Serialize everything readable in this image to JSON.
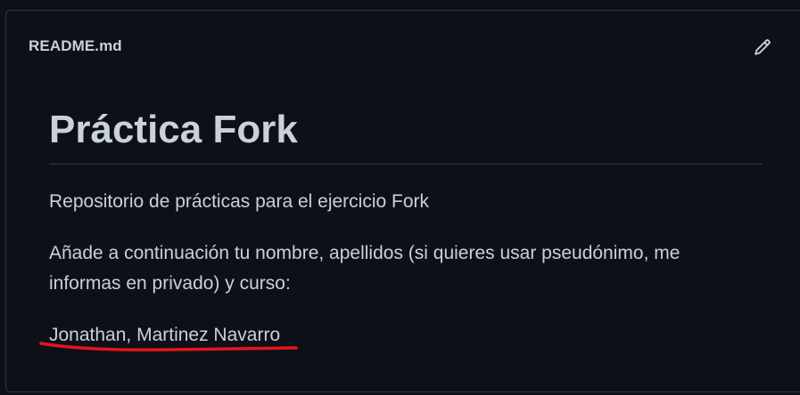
{
  "header": {
    "file_name": "README.md",
    "edit_icon": "pencil-icon"
  },
  "readme": {
    "title": "Práctica Fork",
    "paragraphs": [
      "Repositorio de prácticas para el ejercicio Fork",
      "Añade a continuación tu nombre, apellidos (si quieres usar pseudónimo, me informas en privado) y curso:",
      "Jonathan, Martinez Navarro"
    ]
  },
  "colors": {
    "background": "#0d1117",
    "border": "#30363d",
    "text": "#c9d1d9",
    "annotation_underline": "#e3161b"
  }
}
